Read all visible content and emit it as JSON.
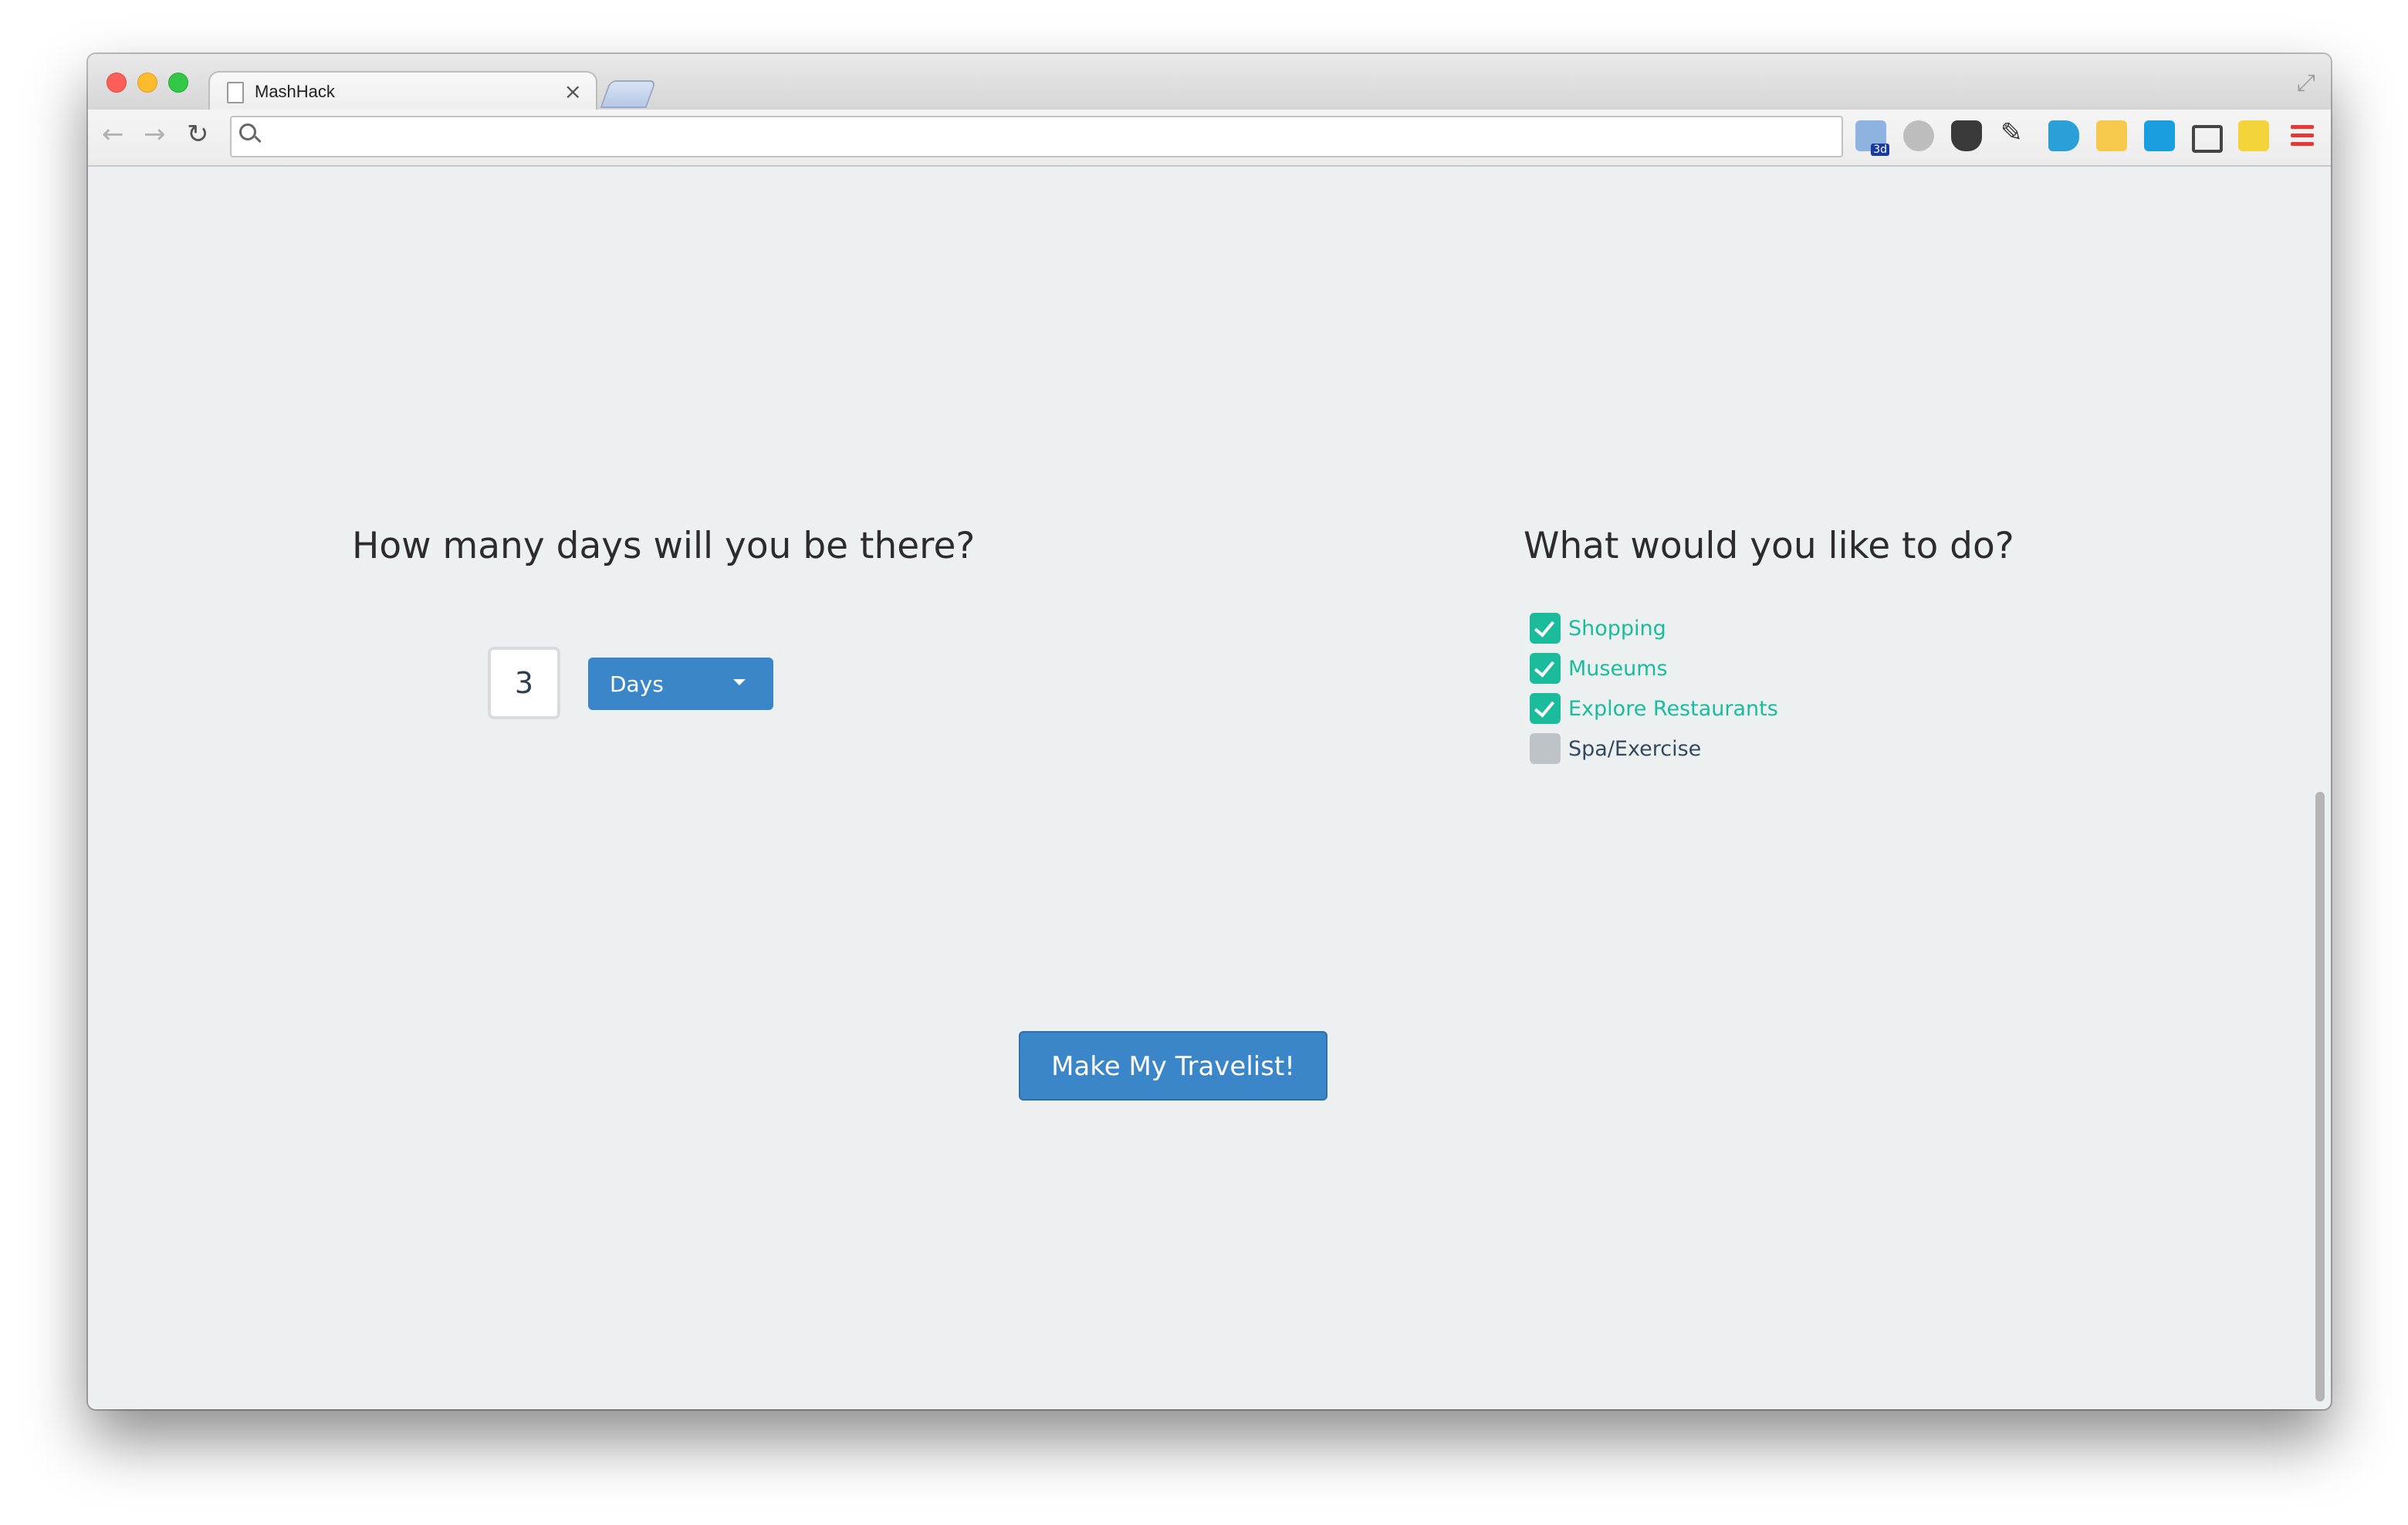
{
  "browser": {
    "tab_title": "MashHack",
    "tab_close": "×",
    "address": "",
    "extensions": [
      {
        "name": "3d-extension-icon",
        "label": "3d"
      },
      {
        "name": "hand-extension-icon"
      },
      {
        "name": "pocket-extension-icon"
      },
      {
        "name": "eyedropper-extension-icon"
      },
      {
        "name": "tag-extension-icon"
      },
      {
        "name": "star-extension-icon"
      },
      {
        "name": "download-extension-icon"
      },
      {
        "name": "cast-extension-icon"
      },
      {
        "name": "sticky-note-extension-icon"
      }
    ],
    "menu": "menu-icon"
  },
  "days_section": {
    "question": "How many days will you be there?",
    "count": "3",
    "unit_selected": "Days"
  },
  "activities_section": {
    "question": "What would you like to do?",
    "options": [
      {
        "label": "Shopping",
        "checked": true
      },
      {
        "label": "Museums",
        "checked": true
      },
      {
        "label": "Explore Restaurants",
        "checked": true
      },
      {
        "label": "Spa/Exercise",
        "checked": false
      }
    ]
  },
  "submit": {
    "label": "Make My Travelist!"
  },
  "colors": {
    "primary": "#3b86c9",
    "checked": "#1abc9c",
    "unchecked": "#bdc3c7",
    "background": "#ecf0f1"
  }
}
